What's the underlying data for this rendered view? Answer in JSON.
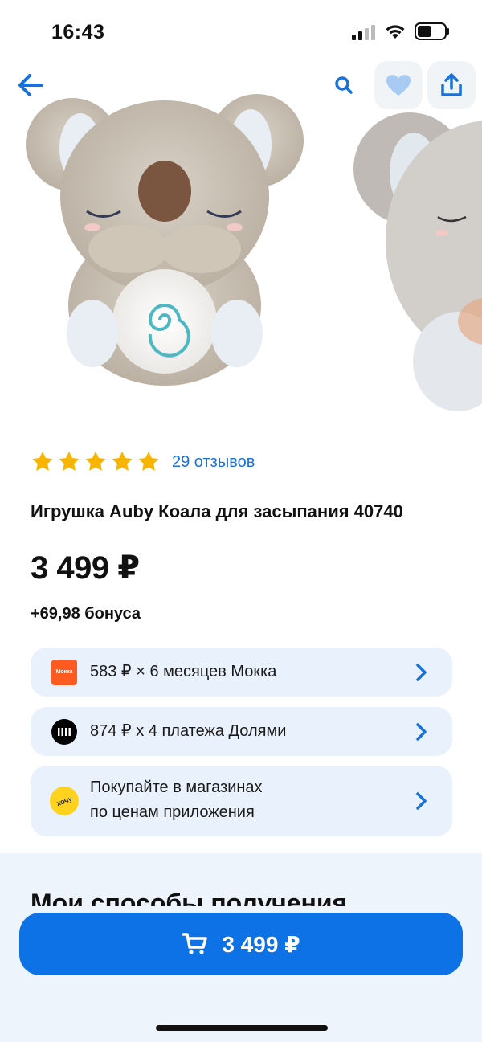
{
  "status_bar": {
    "time": "16:43"
  },
  "product": {
    "rating_stars": 5,
    "reviews_label": "29 отзывов",
    "title": "Игрушка Auby Коала для засыпания 40740",
    "price": "3 499 ₽",
    "bonus": "+69,98 бонуса"
  },
  "payment_options": {
    "mokka": {
      "logo_text": "Мокка",
      "label": "583 ₽ × 6 месяцев Мокка"
    },
    "dolyami": {
      "label": "874 ₽ x 4 платежа Долями"
    },
    "hochu": {
      "logo_text": "хочу",
      "line1": "Покупайте в магазинах",
      "line2": "по ценам приложения"
    }
  },
  "delivery_section": {
    "heading": "Мои способы получения"
  },
  "buy_button": {
    "label": "3 499 ₽"
  },
  "colors": {
    "accent": "#0c72e6",
    "link": "#1872d8",
    "star": "#f7b500",
    "card_bg": "#e8f1fc"
  }
}
